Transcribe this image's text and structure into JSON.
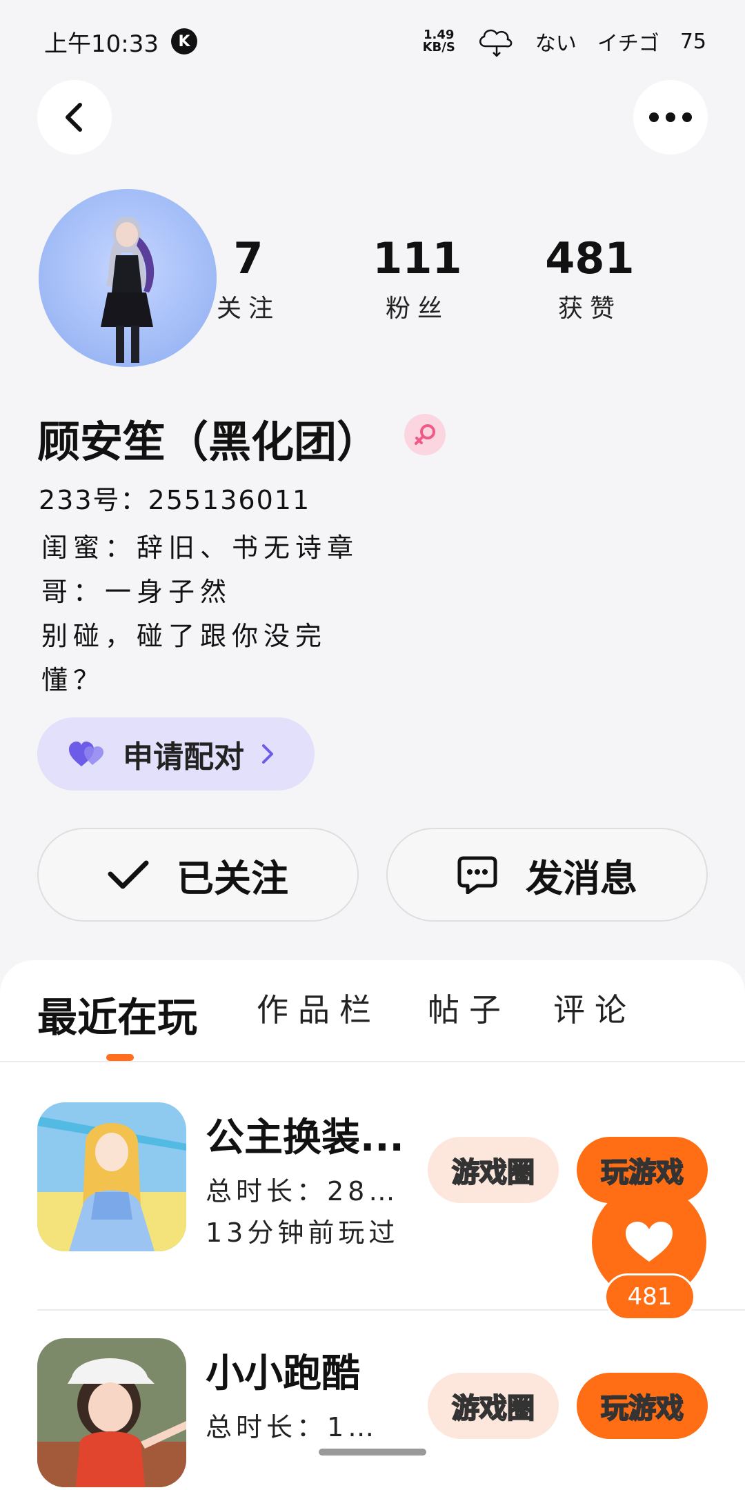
{
  "status_bar": {
    "time": "上午10:33",
    "k_badge": "K",
    "net_speed_value": "1.49",
    "net_speed_unit": "KB/S",
    "signal_text": "ない",
    "carrier_text": "イチゴ",
    "battery": "75"
  },
  "header": {
    "back_icon": "chevron-left-icon",
    "more_icon": "more-horizontal-icon"
  },
  "profile": {
    "stats": [
      {
        "value": "7",
        "label": "关注"
      },
      {
        "value": "111",
        "label": "粉丝"
      },
      {
        "value": "481",
        "label": "获赞"
      }
    ],
    "username": "顾安笙（黑化团）",
    "gender_icon": "female-icon",
    "gender_color": "#f05a86",
    "uid": "233号：255136011",
    "bio_lines": [
      "闺蜜：辞旧、书无诗章",
      "哥：一身子然",
      "别碰，碰了跟你没完",
      "懂？"
    ],
    "pair_button": "申请配对",
    "follow_button": "已关注",
    "message_button": "发消息"
  },
  "tabs": [
    {
      "label": "最近在玩",
      "active": true
    },
    {
      "label": "作品栏",
      "active": false
    },
    {
      "label": "帖子",
      "active": false
    },
    {
      "label": "评论",
      "active": false
    }
  ],
  "games": [
    {
      "title": "公主换装...",
      "duration": "总时长：28…",
      "last_played": "13分钟前玩过",
      "circle_button": "游戏圈",
      "play_button": "玩游戏"
    },
    {
      "title": "小小跑酷",
      "duration": "总时长：1…",
      "circle_button": "游戏圈",
      "play_button": "玩游戏"
    }
  ],
  "floating_like": {
    "count": "481",
    "icon": "heart-icon"
  },
  "colors": {
    "accent": "#ff6d14",
    "pair_bg": "#e2e0fa",
    "pair_heart": "#6c5ce7"
  }
}
